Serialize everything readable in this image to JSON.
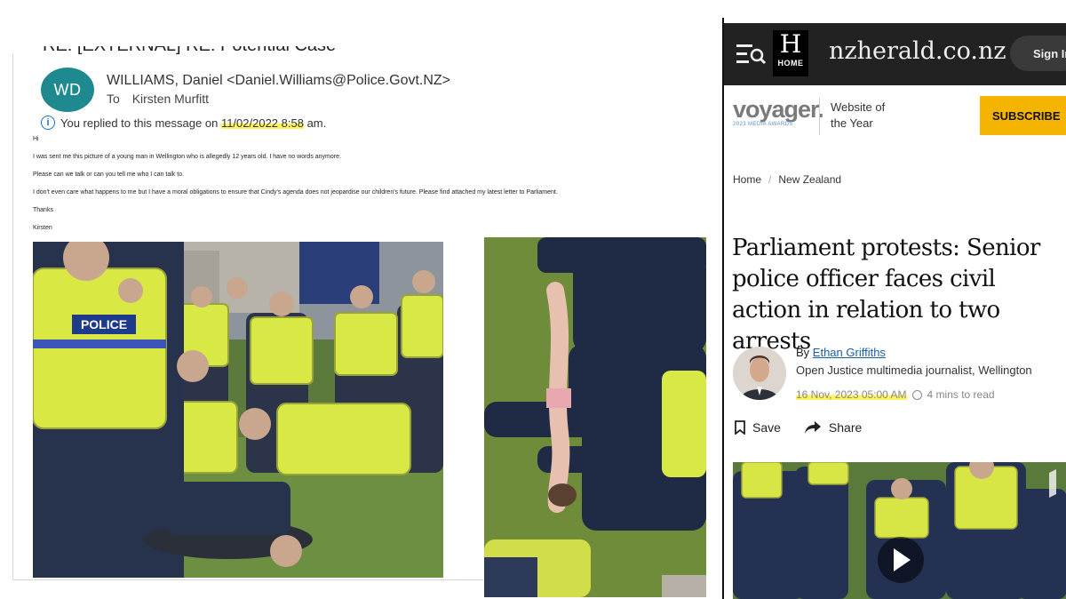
{
  "email": {
    "subject": "RE: [EXTERNAL] RE: Potential Case",
    "avatar_initials": "WD",
    "sender": "WILLIAMS, Daniel <Daniel.Williams@Police.Govt.NZ>",
    "to_label": "To",
    "recipient": "Kirsten Murfitt",
    "replied_prefix": "You replied to this message on",
    "replied_date": "11/02/2022 8:58",
    "replied_suffix": "am.",
    "body": [
      "Hi",
      "I was sent me this picture of a young man in Wellington who is allegedly 12 years old. I have no words anymore.",
      "Please can we talk or can you tell me who I can talk to.",
      "I don't even care what happens to me but I have a moral obligations to ensure that Cindy's agenda does not jeopardise our children's future. Please find attached my latest letter to Parliament.",
      "Thanks",
      "Kirsten"
    ],
    "vest_text": "POLICE"
  },
  "article": {
    "logo_glyph": "H",
    "home_label": "HOME",
    "site_name": "nzherald.co.nz",
    "signin_label": "Sign In",
    "voyager_brand": "voyager.",
    "voyager_awards": "2023 MEDIA AWARDS",
    "award_line1": "Website of",
    "award_line2": "the Year",
    "subscribe_label": "SUBSCRIBE",
    "breadcrumb_home": "Home",
    "breadcrumb_section": "New Zealand",
    "headline": "Parliament protests: Senior police officer faces civil action in relation to two arrests",
    "by_label": "By",
    "author": "Ethan Griffiths",
    "author_role": "Open Justice multimedia journalist, Wellington",
    "published": "16 Nov, 2023 05:00 AM",
    "read_time": "4 mins to read",
    "save_label": "Save",
    "share_label": "Share"
  },
  "colors": {
    "avatar": "#1e8a8f",
    "highlight": "#fff25a",
    "subscribe": "#f4b400",
    "topbar": "#222222",
    "link": "#1a5fa8"
  },
  "icons": [
    "info-icon",
    "menu-search-icon",
    "bookmark-icon",
    "share-arrow-icon",
    "clock-icon",
    "play-icon"
  ]
}
